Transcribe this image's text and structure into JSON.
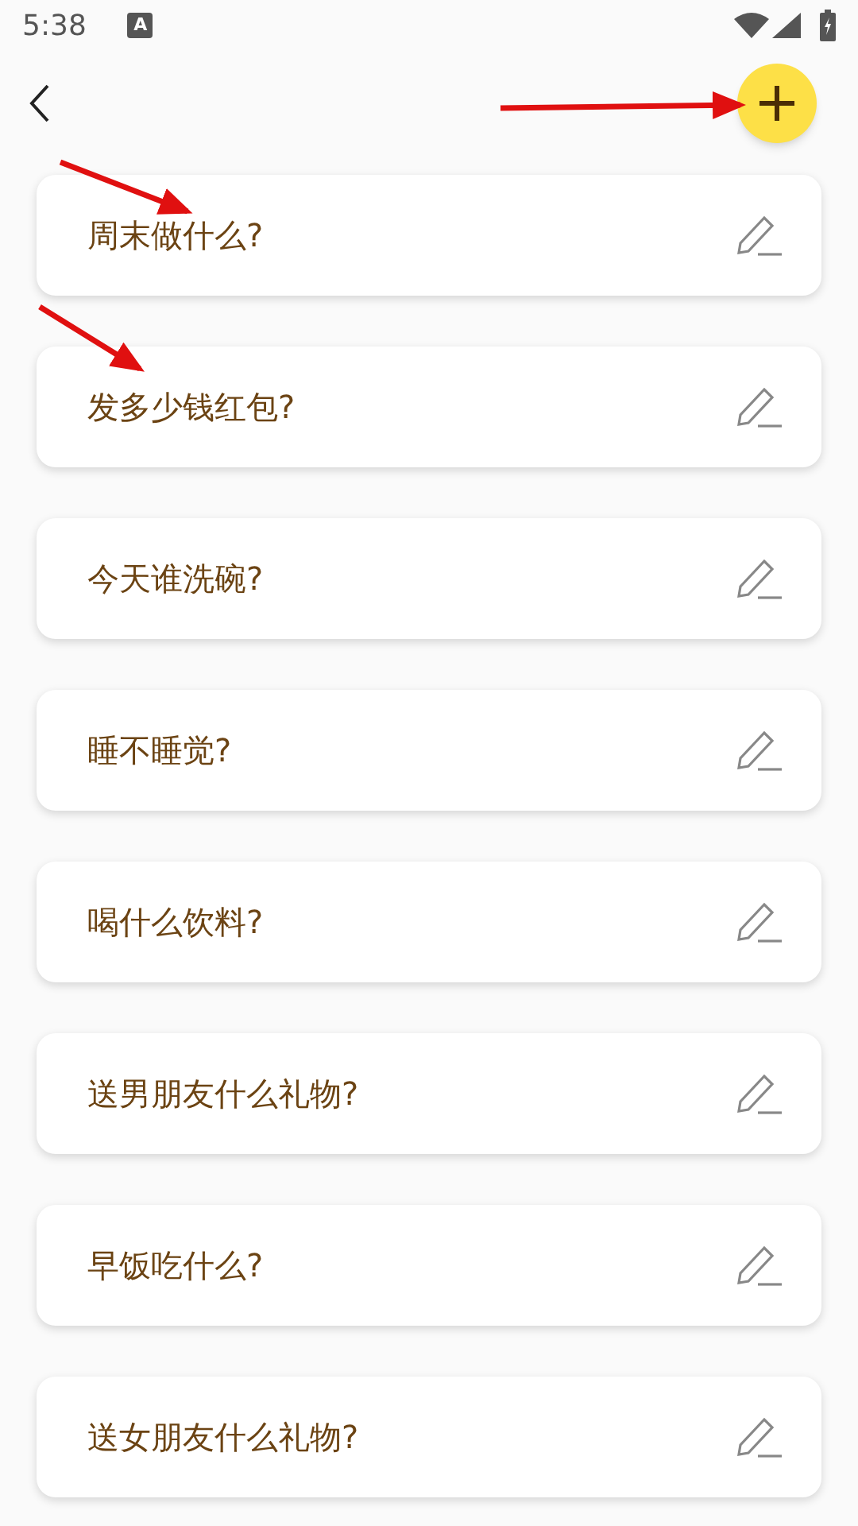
{
  "status_bar": {
    "time": "5:38",
    "notification": "A"
  },
  "items": [
    {
      "title": "周末做什么?"
    },
    {
      "title": "发多少钱红包?"
    },
    {
      "title": "今天谁洗碗?"
    },
    {
      "title": "睡不睡觉?"
    },
    {
      "title": "喝什么饮料?"
    },
    {
      "title": "送男朋友什么礼物?"
    },
    {
      "title": "早饭吃什么?"
    },
    {
      "title": "送女朋友什么礼物?"
    }
  ]
}
